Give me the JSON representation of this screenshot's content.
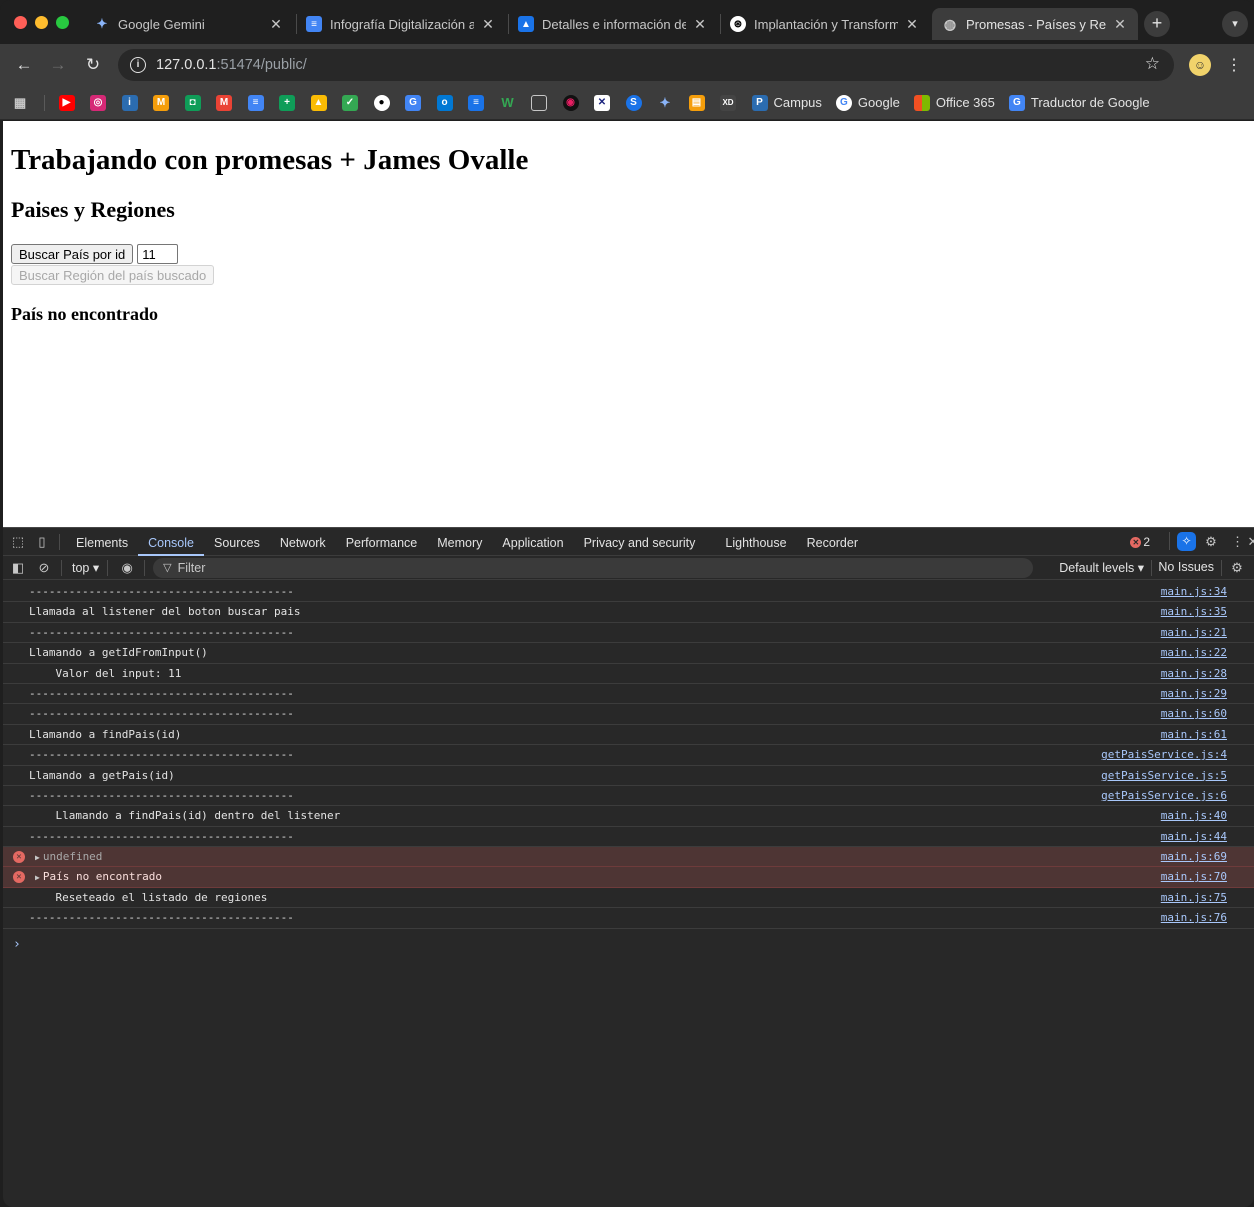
{
  "tabs": [
    {
      "title": "Google Gemini",
      "icon": "gemini-icon",
      "active": false
    },
    {
      "title": "Infografía Digitalización au",
      "icon": "docs-icon",
      "active": false
    },
    {
      "title": "Detalles e información de",
      "icon": "slides-icon",
      "active": false
    },
    {
      "title": "Implantación y Transform",
      "icon": "chatgpt-icon",
      "active": false
    },
    {
      "title": "Promesas - Países y Regi",
      "icon": "globe-icon",
      "active": true
    }
  ],
  "address": {
    "host": "127.0.0.1",
    "path": ":51474/public/"
  },
  "bookmarks": [
    {
      "label": "Campus",
      "icon": "ifp-icon"
    },
    {
      "label": "Google",
      "icon": "google-icon"
    },
    {
      "label": "Office 365",
      "icon": "office-icon"
    },
    {
      "label": "Traductor de Google",
      "icon": "translate-icon"
    }
  ],
  "page": {
    "title": "Trabajando con promesas + James Ovalle",
    "subtitle": "Paises y Regiones",
    "search_button": "Buscar País por id",
    "id_value": "11",
    "region_button": "Buscar Región del país buscado",
    "result": "País no encontrado"
  },
  "devtools": {
    "tabs": [
      "Elements",
      "Console",
      "Sources",
      "Network",
      "Performance",
      "Memory",
      "Application",
      "Privacy and security",
      "Lighthouse",
      "Recorder"
    ],
    "active_tab": "Console",
    "error_count": "2",
    "context": "top ▾",
    "filter_placeholder": "Filter",
    "levels": "Default levels ▾",
    "issues": "No Issues",
    "logs": [
      {
        "text": "----------------------------------------",
        "src": "main.js:34",
        "type": "log"
      },
      {
        "text": "Llamada al listener del boton buscar pais",
        "src": "main.js:35",
        "type": "log"
      },
      {
        "text": "----------------------------------------",
        "src": "main.js:21",
        "type": "log"
      },
      {
        "text": "Llamando a getIdFromInput()",
        "src": "main.js:22",
        "type": "log"
      },
      {
        "text": "    Valor del input: 11",
        "src": "main.js:28",
        "type": "log"
      },
      {
        "text": "----------------------------------------",
        "src": "main.js:29",
        "type": "log"
      },
      {
        "text": "----------------------------------------",
        "src": "main.js:60",
        "type": "log"
      },
      {
        "text": "Llamando a findPais(id)",
        "src": "main.js:61",
        "type": "log"
      },
      {
        "text": "----------------------------------------",
        "src": "getPaisService.js:4",
        "type": "log"
      },
      {
        "text": "Llamando a getPais(id)",
        "src": "getPaisService.js:5",
        "type": "log"
      },
      {
        "text": "----------------------------------------",
        "src": "getPaisService.js:6",
        "type": "log"
      },
      {
        "text": "    Llamando a findPais(id) dentro del listener",
        "src": "main.js:40",
        "type": "log"
      },
      {
        "text": "----------------------------------------",
        "src": "main.js:44",
        "type": "log"
      },
      {
        "text": "undefined",
        "src": "main.js:69",
        "type": "error-dim"
      },
      {
        "text": "País no encontrado",
        "src": "main.js:70",
        "type": "error"
      },
      {
        "text": "    Reseteado el listado de regiones",
        "src": "main.js:75",
        "type": "log"
      },
      {
        "text": "----------------------------------------",
        "src": "main.js:76",
        "type": "log"
      }
    ],
    "prompt": "›"
  }
}
